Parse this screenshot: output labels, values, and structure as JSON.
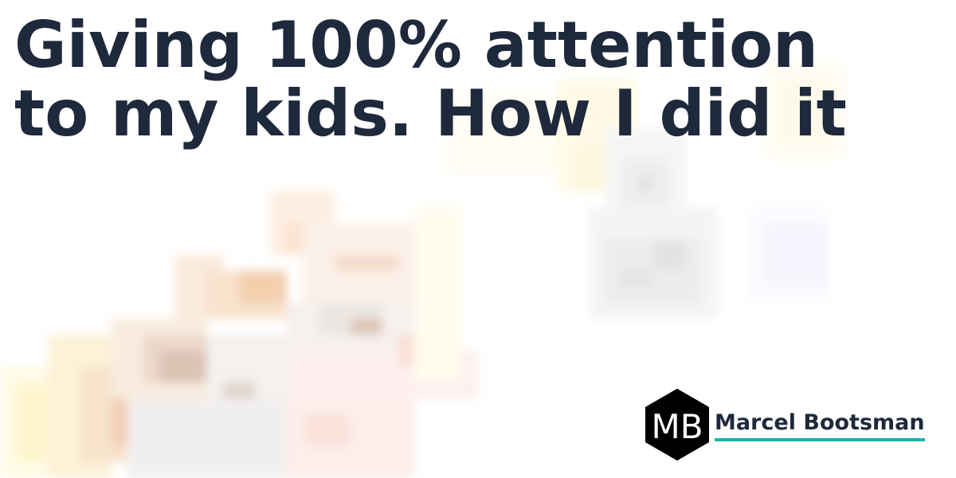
{
  "post": {
    "title_line_1": "Giving 100% attention",
    "title_line_2": "to my kids. How I did it"
  },
  "author": {
    "name": "Marcel Bootsman",
    "logo_text": "MB"
  },
  "colors": {
    "title": "#1e293b",
    "author_underline": "#14b8a6",
    "logo_background": "#000000",
    "logo_text": "#ffffff"
  },
  "icons": {
    "logo": "mb-hexagon-logo"
  }
}
